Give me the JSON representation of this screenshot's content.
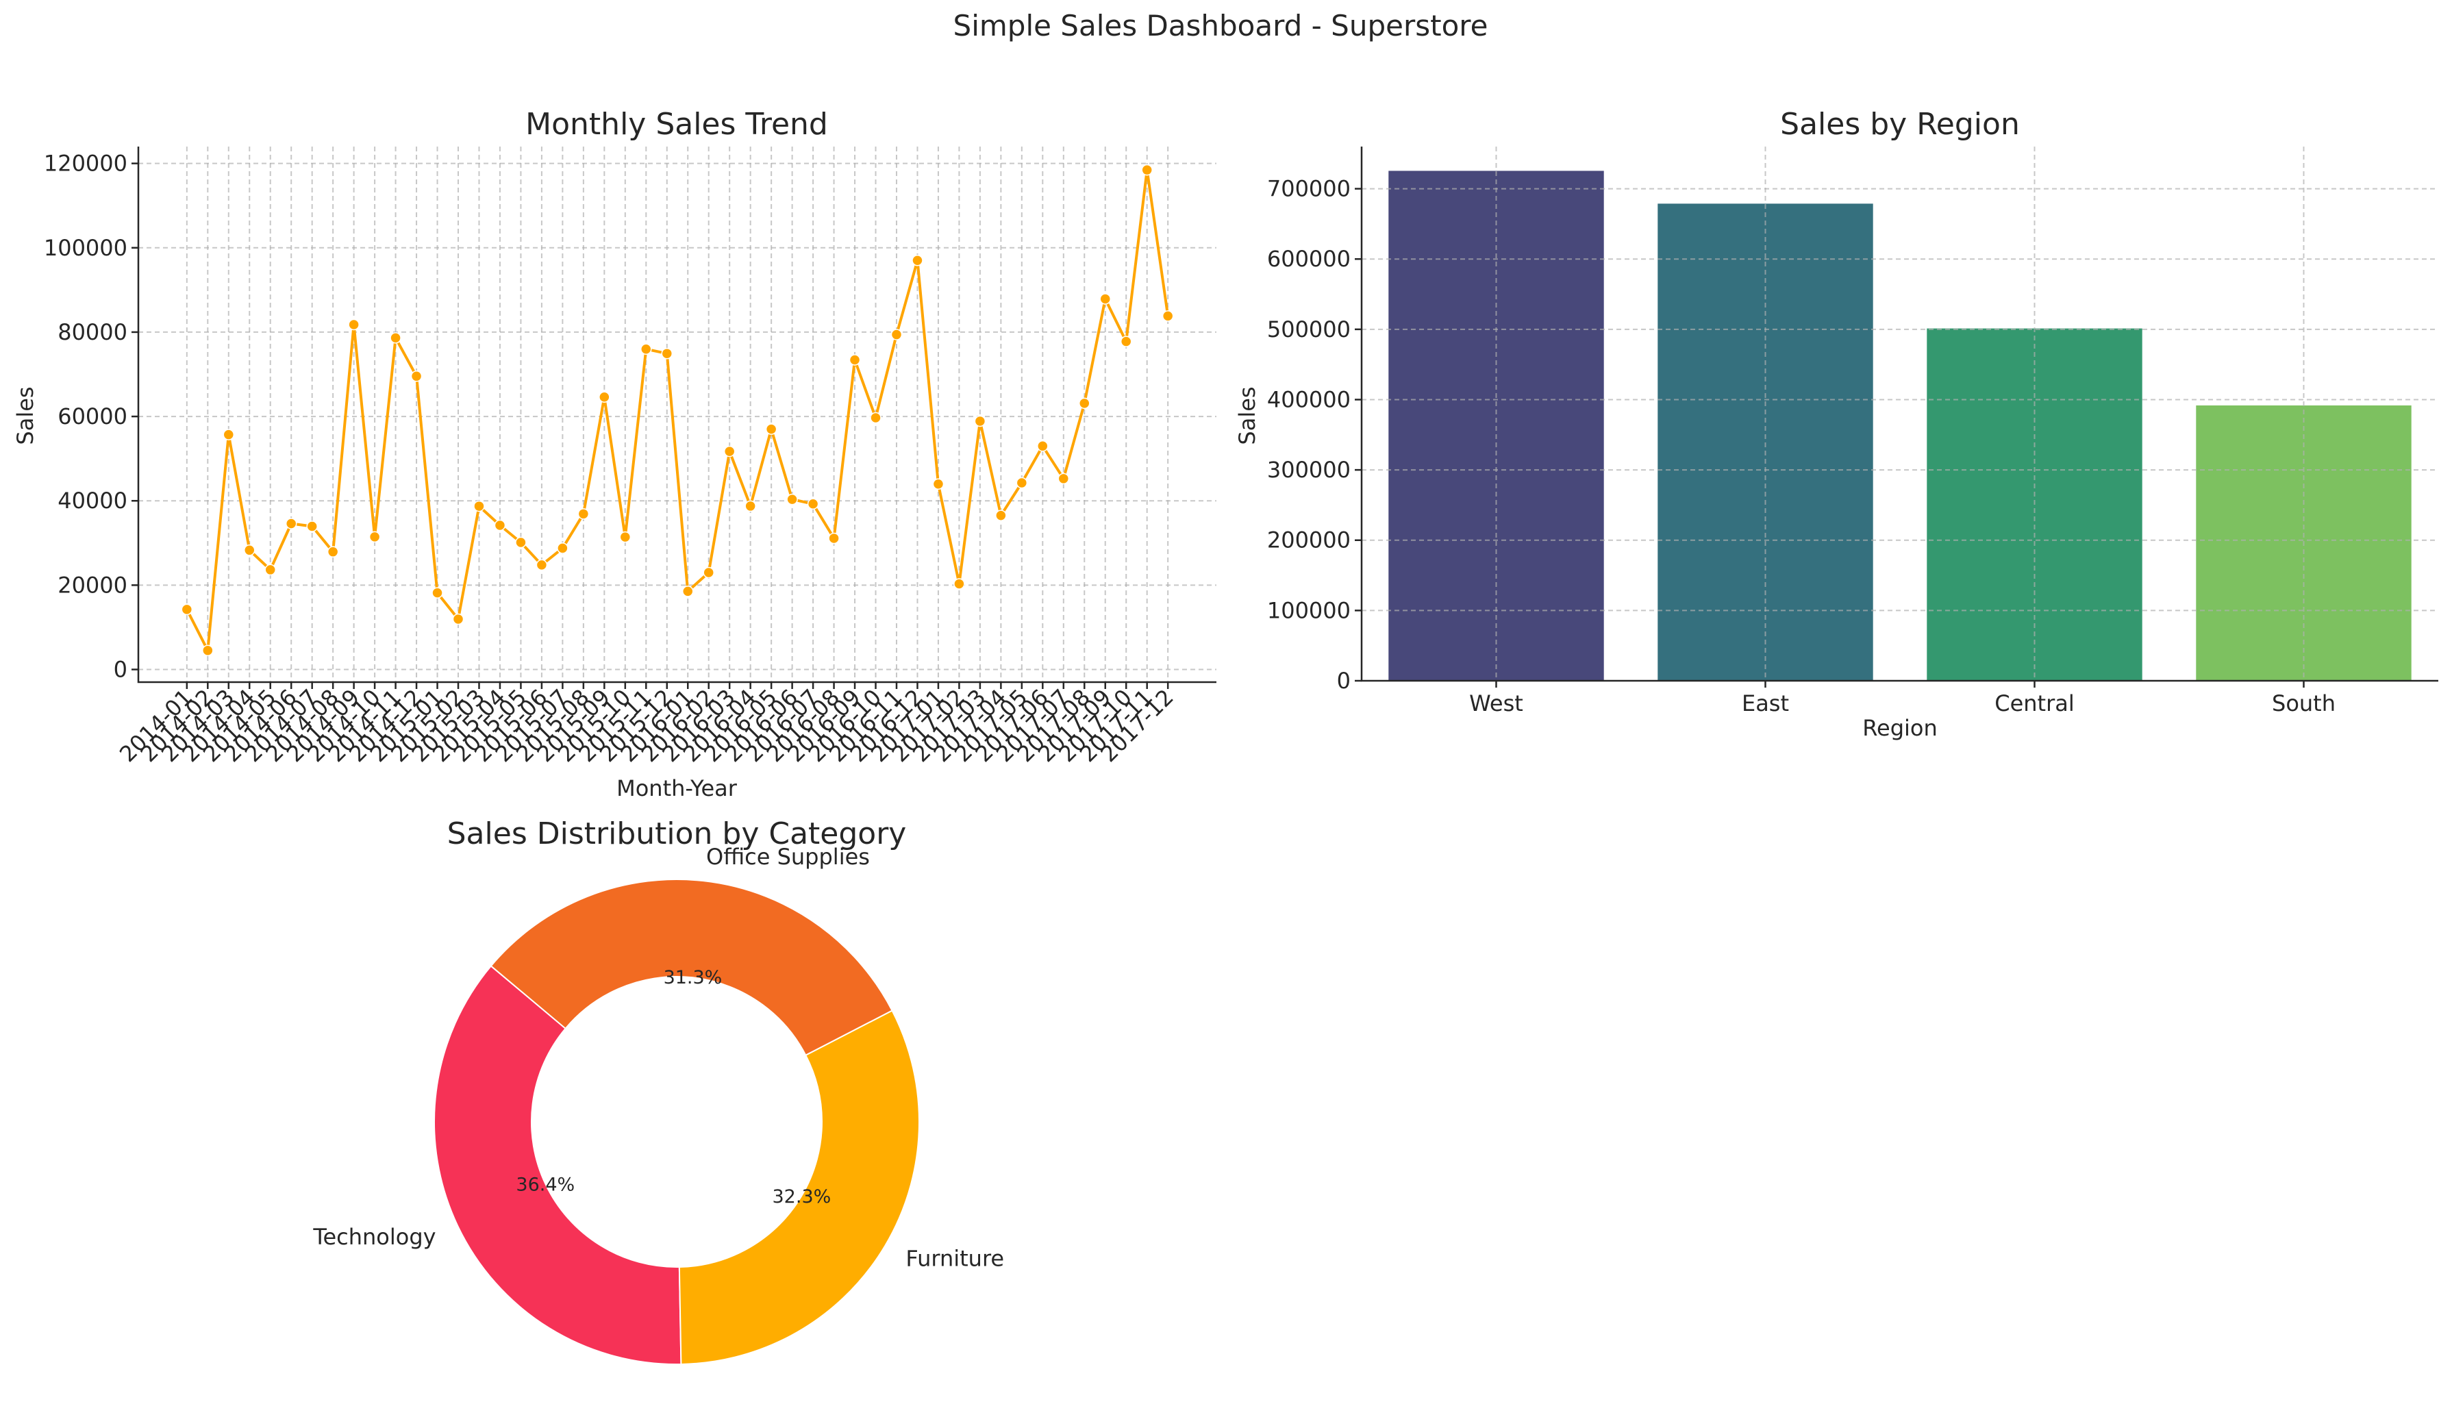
{
  "dashboard_title": "Simple Sales Dashboard - Superstore",
  "colors": {
    "line": "#FFA500",
    "region_bars": [
      "#48487A",
      "#35707E",
      "#34986F",
      "#7DC160"
    ],
    "category_slices": [
      "#F63256",
      "#FFAD00",
      "#F26B22"
    ]
  },
  "chart_data": [
    {
      "type": "line",
      "title": "Monthly Sales Trend",
      "xlabel": "Month-Year",
      "ylabel": "Sales",
      "ylim": [
        -3000,
        124000
      ],
      "yticks": [
        0,
        20000,
        40000,
        60000,
        80000,
        100000,
        120000
      ],
      "grid": true,
      "marker": "circle",
      "x": [
        "2014-01",
        "2014-02",
        "2014-03",
        "2014-04",
        "2014-05",
        "2014-06",
        "2014-07",
        "2014-08",
        "2014-09",
        "2014-10",
        "2014-11",
        "2014-12",
        "2015-01",
        "2015-02",
        "2015-03",
        "2015-04",
        "2015-05",
        "2015-06",
        "2015-07",
        "2015-08",
        "2015-09",
        "2015-10",
        "2015-11",
        "2015-12",
        "2016-01",
        "2016-02",
        "2016-03",
        "2016-04",
        "2016-05",
        "2016-06",
        "2016-07",
        "2016-08",
        "2016-09",
        "2016-10",
        "2016-11",
        "2016-12",
        "2017-01",
        "2017-02",
        "2017-03",
        "2017-04",
        "2017-05",
        "2017-06",
        "2017-07",
        "2017-08",
        "2017-09",
        "2017-10",
        "2017-11",
        "2017-12"
      ],
      "values": [
        14237,
        4520,
        55691,
        28295,
        23648,
        34595,
        33946,
        27909,
        81777,
        31453,
        78629,
        69546,
        18174,
        11951,
        38726,
        34195,
        30132,
        24797,
        28765,
        36898,
        64596,
        31405,
        75972,
        74920,
        18542,
        22979,
        51716,
        38750,
        56988,
        40345,
        39262,
        31115,
        73410,
        59688,
        79412,
        96999,
        43971,
        20301,
        58872,
        36522,
        44261,
        52982,
        45264,
        63121,
        87867,
        77777,
        118448,
        83829
      ]
    },
    {
      "type": "bar",
      "title": "Sales by Region",
      "xlabel": "Region",
      "ylabel": "Sales",
      "ylim": [
        0,
        760000
      ],
      "yticks": [
        0,
        100000,
        200000,
        300000,
        400000,
        500000,
        600000,
        700000
      ],
      "grid": true,
      "categories": [
        "West",
        "East",
        "Central",
        "South"
      ],
      "values": [
        725458,
        678781,
        501240,
        391722
      ]
    },
    {
      "type": "pie",
      "title": "Sales Distribution by Category",
      "style": "donut",
      "slices": [
        {
          "label": "Technology",
          "value": 36.4,
          "pct_label": "36.4%"
        },
        {
          "label": "Furniture",
          "value": 32.3,
          "pct_label": "32.3%"
        },
        {
          "label": "Office Supplies",
          "value": 31.3,
          "pct_label": "31.3%"
        }
      ]
    }
  ]
}
